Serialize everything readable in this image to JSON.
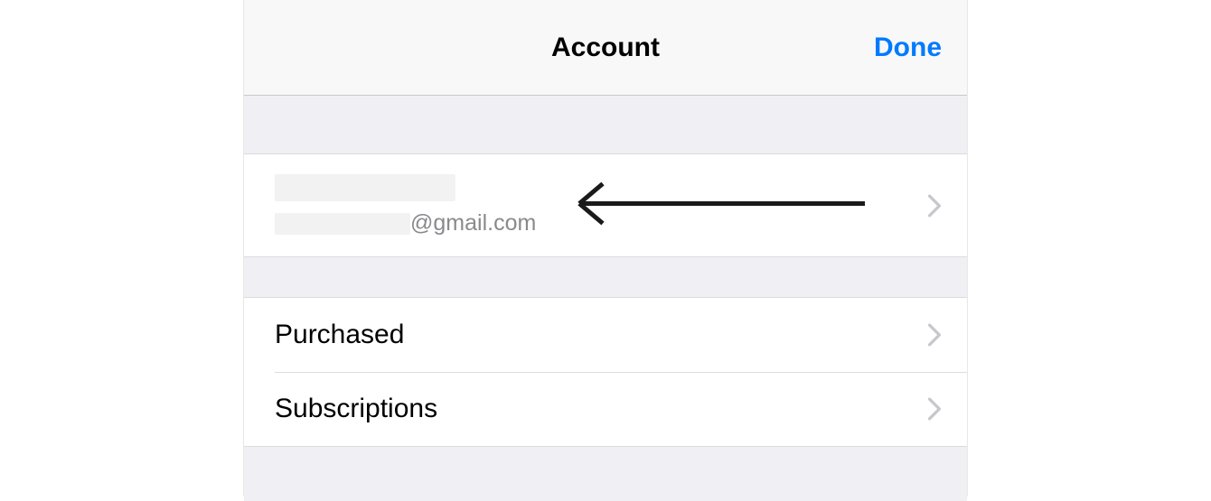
{
  "navbar": {
    "title": "Account",
    "done_label": "Done"
  },
  "account": {
    "email_domain": "@gmail.com"
  },
  "menu": {
    "purchased_label": "Purchased",
    "subscriptions_label": "Subscriptions"
  }
}
